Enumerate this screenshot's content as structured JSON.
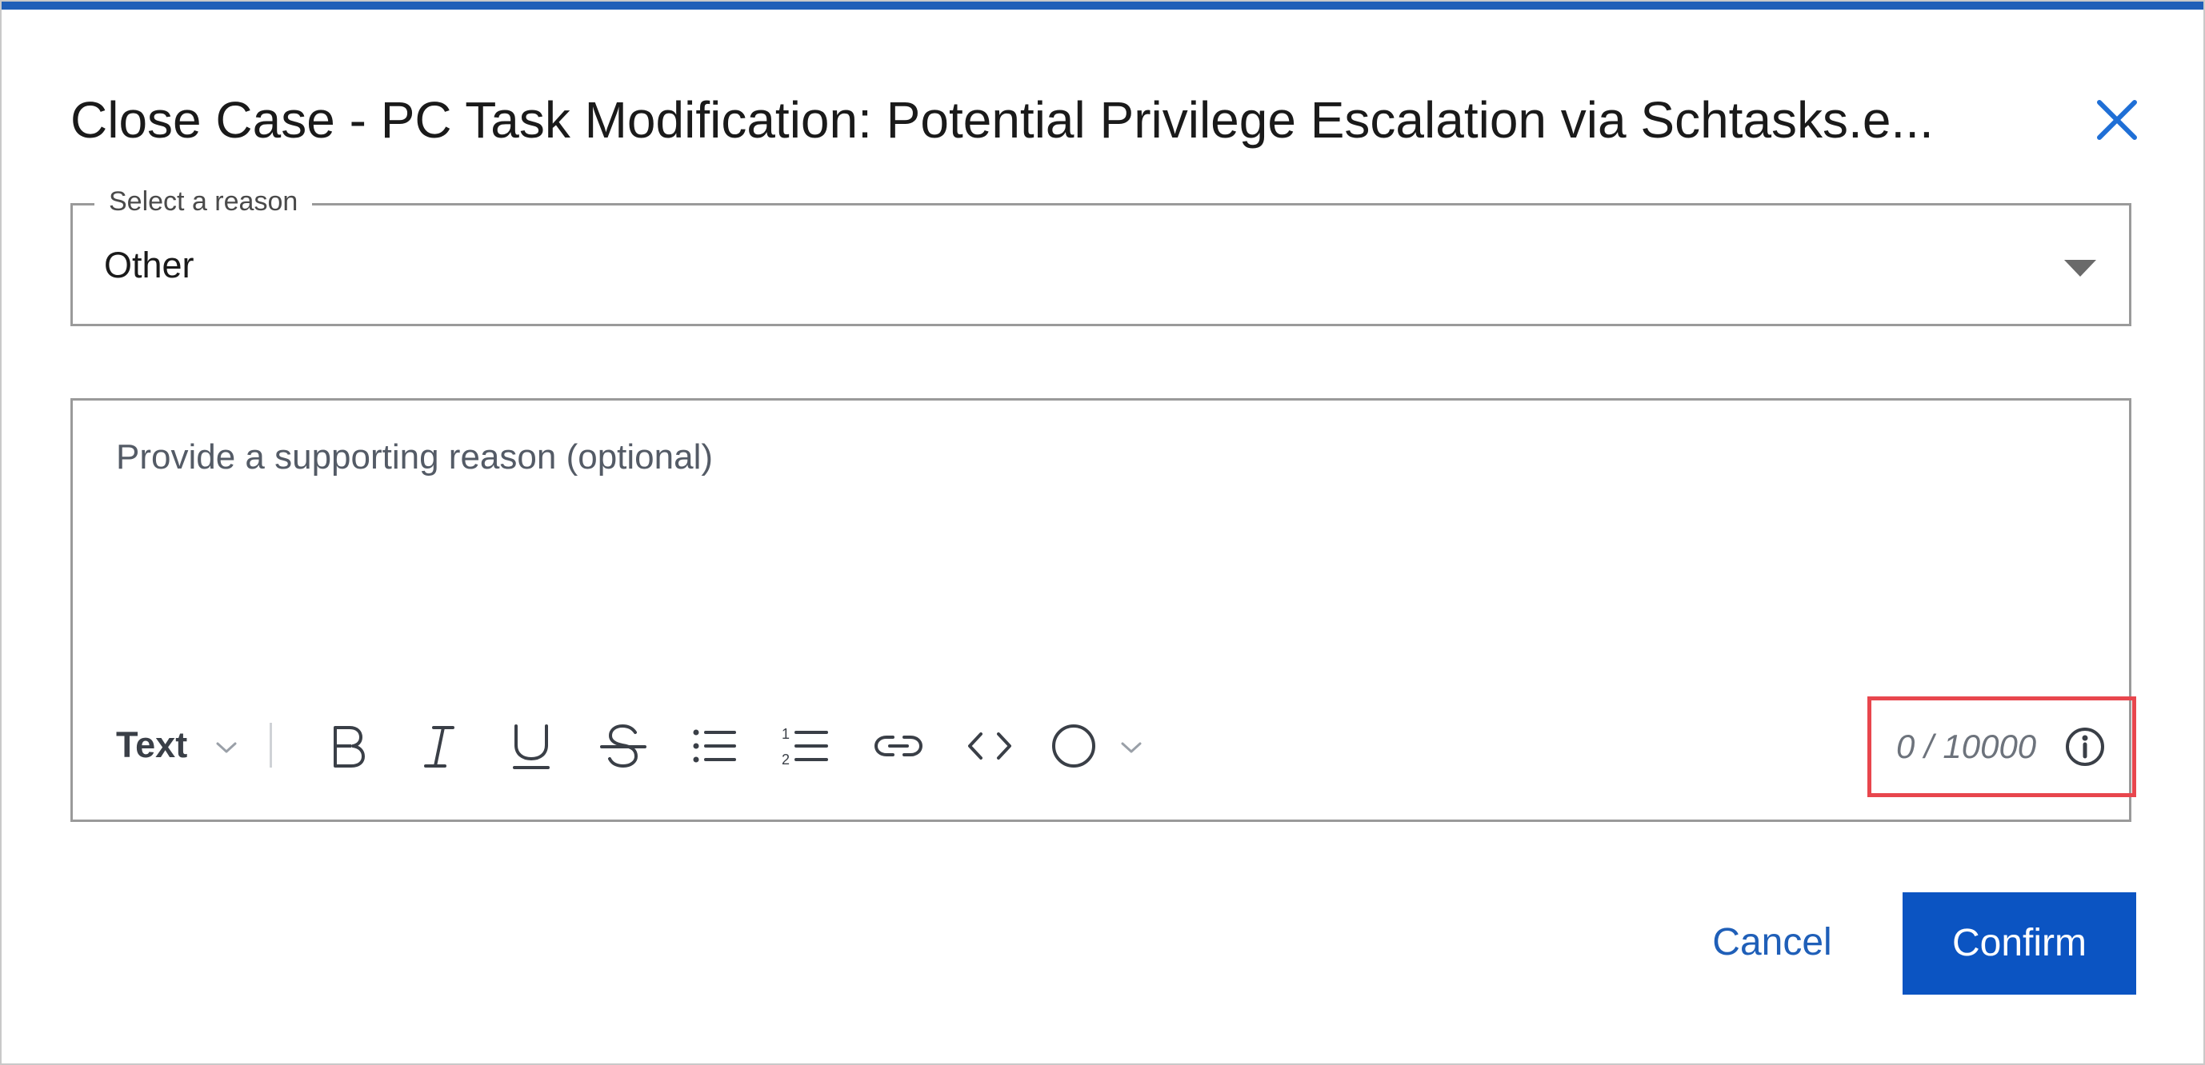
{
  "dialog": {
    "title": "Close Case - PC Task Modification: Potential Privilege Escalation via Schtasks.e...",
    "close_icon": "close-icon",
    "accent_color": "#1f5fb8"
  },
  "reason_select": {
    "label": "Select a reason",
    "value": "Other",
    "caret_icon": "caret-down-icon"
  },
  "editor": {
    "placeholder": "Provide a supporting reason (optional)",
    "toolbar": {
      "text_style_label": "Text",
      "buttons": [
        {
          "name": "bold",
          "icon": "bold-icon"
        },
        {
          "name": "italic",
          "icon": "italic-icon"
        },
        {
          "name": "underline",
          "icon": "underline-icon"
        },
        {
          "name": "strikethrough",
          "icon": "strikethrough-icon"
        },
        {
          "name": "bullet-list",
          "icon": "bullet-list-icon"
        },
        {
          "name": "numbered-list",
          "icon": "numbered-list-icon"
        },
        {
          "name": "link",
          "icon": "link-icon"
        },
        {
          "name": "code",
          "icon": "code-icon"
        },
        {
          "name": "color",
          "icon": "circle-icon"
        }
      ]
    },
    "counter": "0 / 10000",
    "counter_highlight_color": "#e8464d"
  },
  "actions": {
    "cancel_label": "Cancel",
    "confirm_label": "Confirm",
    "confirm_color": "#0b54c2"
  }
}
